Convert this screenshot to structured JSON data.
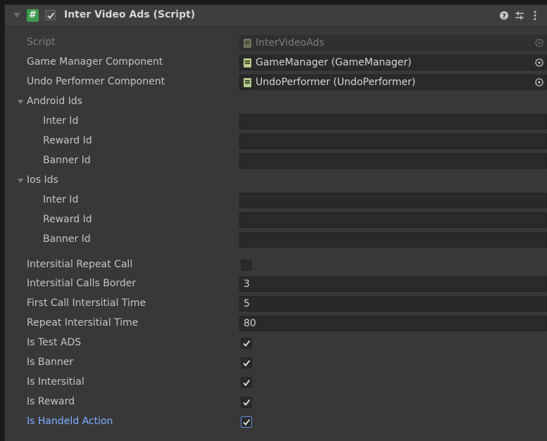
{
  "component": {
    "title": "Inter Video Ads (Script)",
    "icon_glyph": "#",
    "enabled": true
  },
  "header_icons": [
    "help-icon",
    "preset-icon",
    "kebab-menu-icon"
  ],
  "script_field": {
    "label": "Script",
    "value": "InterVideoAds"
  },
  "game_manager": {
    "label": "Game Manager Component",
    "value": "GameManager (GameManager)"
  },
  "undo_performer": {
    "label": "Undo Performer Component",
    "value": "UndoPerformer (UndoPerformer)"
  },
  "android_ids": {
    "label": "Android Ids",
    "inter_label": "Inter Id",
    "inter_value": "",
    "reward_label": "Reward Id",
    "reward_value": "",
    "banner_label": "Banner Id",
    "banner_value": ""
  },
  "ios_ids": {
    "label": "Ios Ids",
    "inter_label": "Inter Id",
    "inter_value": "",
    "reward_label": "Reward Id",
    "reward_value": "",
    "banner_label": "Banner Id",
    "banner_value": ""
  },
  "intersitial_repeat_call": {
    "label": "Intersitial Repeat Call",
    "checked": false
  },
  "intersitial_calls_border": {
    "label": "Intersitial Calls Border",
    "value": "3"
  },
  "first_call_intersitial_time": {
    "label": "First Call Intersitial Time",
    "value": "5"
  },
  "repeat_intersitial_time": {
    "label": "Repeat Intersitial Time",
    "value": "80"
  },
  "is_test_ads": {
    "label": "Is Test ADS",
    "checked": true
  },
  "is_banner": {
    "label": "Is Banner",
    "checked": true
  },
  "is_intersitial": {
    "label": "Is Intersitial",
    "checked": true
  },
  "is_reward": {
    "label": "Is Reward",
    "checked": true
  },
  "is_handeld_action": {
    "label": "Is Handeld Action",
    "checked": true
  },
  "colors": {
    "panel_bg": "#383838",
    "field_bg": "#2a2a2a",
    "script_icon": "#3c9a50",
    "focus_label": "#7fb0ff",
    "focus_border": "#5d8fe0"
  }
}
